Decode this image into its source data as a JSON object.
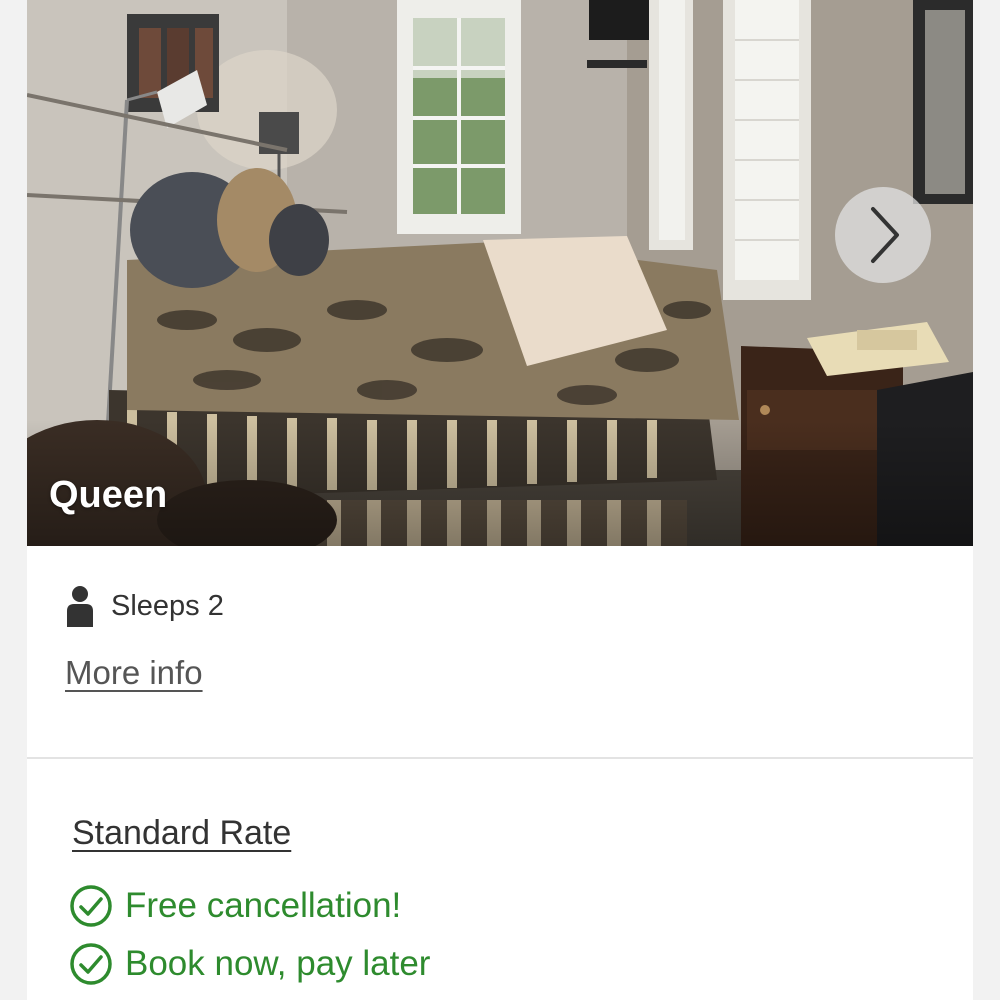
{
  "room": {
    "name": "Queen",
    "sleeps_label": "Sleeps 2",
    "more_info_label": "More info"
  },
  "carousel": {
    "next_icon": "chevron-right-icon"
  },
  "rate": {
    "title": "Standard Rate",
    "features": [
      {
        "label": "Free cancellation!",
        "icon": "check-circle-icon"
      },
      {
        "label": "Book now, pay later",
        "icon": "check-circle-icon"
      }
    ]
  },
  "colors": {
    "feature_green": "#2e8b2e",
    "text_dark": "#333333",
    "card_bg": "#ffffff",
    "page_bg": "#f2f2f2"
  }
}
